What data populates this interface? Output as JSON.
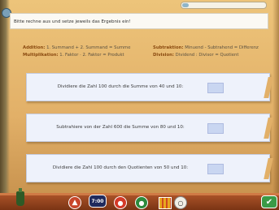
{
  "instruction": "Bitte rechne aus und setze jeweils das Ergebnis ein!",
  "info": {
    "addition": {
      "label": "Addition:",
      "text": "1. Summand + 2. Summand = Summe"
    },
    "subtraktion": {
      "label": "Subtraktion:",
      "text": "Minuend - Subtrahend = Differenz"
    },
    "multiplikation": {
      "label": "Multiplikation:",
      "text": "1. Faktor · 2. Faktor = Produkt"
    },
    "division": {
      "label": "Division:",
      "text": "Dividend : Divisor = Quotient"
    }
  },
  "tasks": [
    {
      "text": "Dividiere die Zahl 100 durch die Summe von 40 und 10:",
      "answer": ""
    },
    {
      "text": "Subtrahiere von der Zahl 600 die Summe von 80 und 10:",
      "answer": ""
    },
    {
      "text": "Dividiere die Zahl 100 durch den Quotienten von 50 und 10:",
      "answer": ""
    }
  ],
  "toolbar": {
    "btn1_glyph": "▲",
    "btn2_label": "7:00",
    "btn3_glyph": "●",
    "btn4_glyph": "●",
    "btn6_glyph": "○",
    "check_glyph": "✔"
  },
  "colors": {
    "accent": "#8a4a10",
    "card": "#eef2fb",
    "answer_box": "#c9d6f1",
    "bottom_bar": "#9a4420"
  }
}
